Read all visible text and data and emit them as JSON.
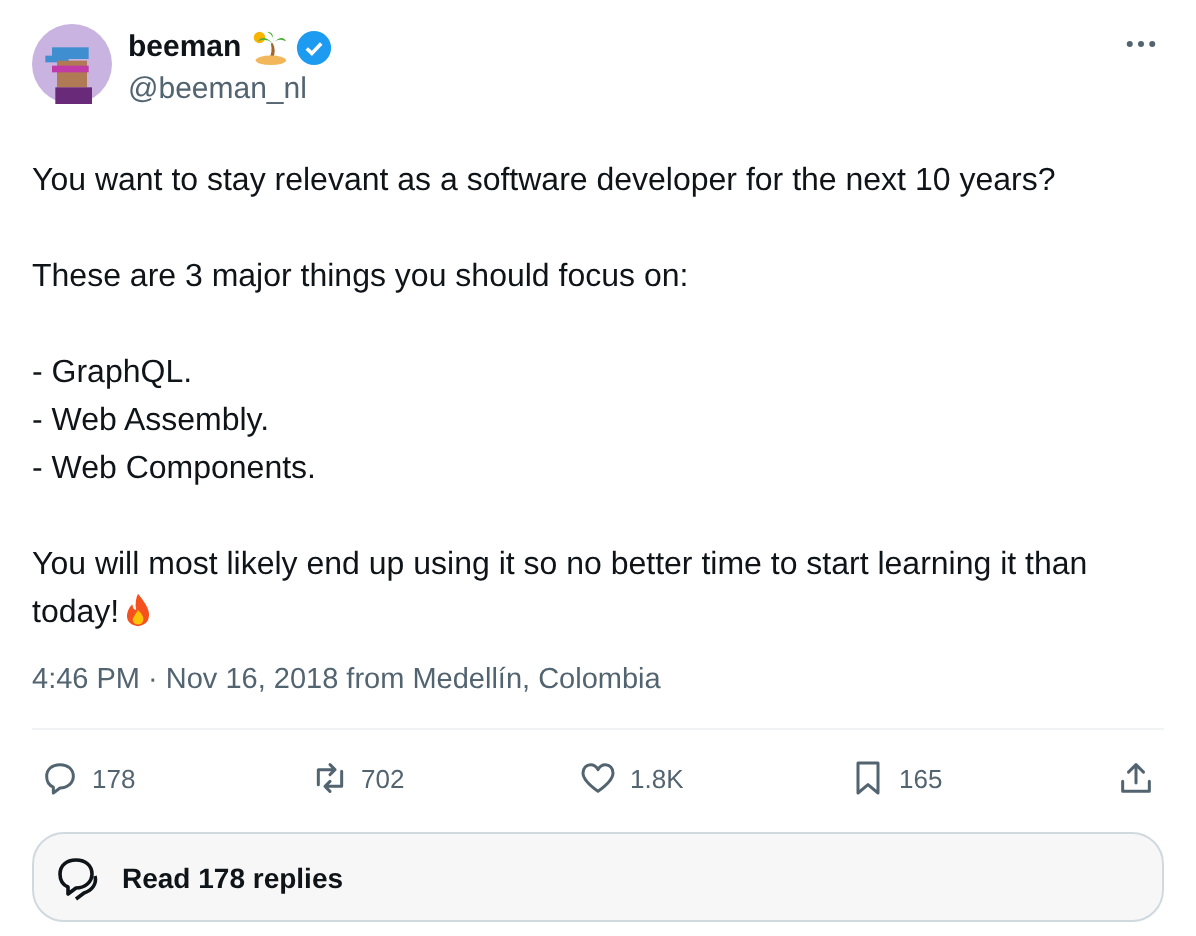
{
  "author": {
    "name": "beeman",
    "handle": "@beeman_nl",
    "verified": true
  },
  "paragraphs": [
    [
      "You want to stay relevant as a software developer for the next 10 years?"
    ],
    [
      "These are 3 major things you should focus on:"
    ],
    [
      "- GraphQL.",
      "- Web Assembly.",
      "- Web Components."
    ],
    [
      "You will most likely end up using it so no better time to start learning it than today!"
    ]
  ],
  "timestamp": "4:46 PM · Nov 16, 2018 from Medellín, Colombia",
  "actions": [
    {
      "kind": "reply",
      "count": "178"
    },
    {
      "kind": "repost",
      "count": "702"
    },
    {
      "kind": "like",
      "count": "1.8K"
    },
    {
      "kind": "bookmark",
      "count": "165"
    },
    {
      "kind": "share"
    }
  ],
  "read_replies": "Read 178 replies"
}
